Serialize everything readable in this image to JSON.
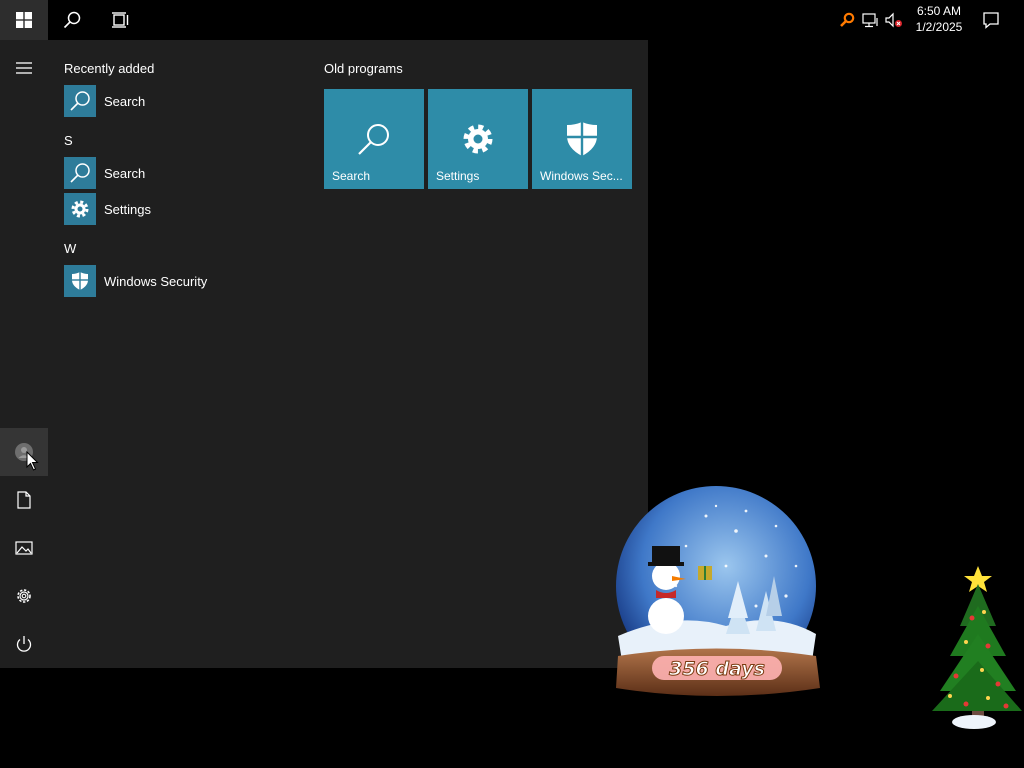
{
  "taskbar": {
    "clock_time": "6:50 AM",
    "clock_date": "1/2/2025",
    "icons": [
      "windows-logo-icon",
      "search-icon",
      "task-view-icon",
      "search-tray-icon",
      "network-icon",
      "volume-muted-icon",
      "notification-icon"
    ],
    "accent": "#ff7a00"
  },
  "start_menu": {
    "recently_added_title": "Recently added",
    "recently_added": [
      {
        "label": "Search",
        "icon": "search-icon"
      }
    ],
    "letter_s": "S",
    "s_items": [
      {
        "label": "Search",
        "icon": "search-icon"
      },
      {
        "label": "Settings",
        "icon": "gear-icon"
      }
    ],
    "letter_w": "W",
    "w_items": [
      {
        "label": "Windows Security",
        "icon": "shield-icon"
      }
    ],
    "rail": [
      "hamburger-icon",
      "user-icon",
      "documents-icon",
      "pictures-icon",
      "settings-icon",
      "power-icon"
    ]
  },
  "tiles": {
    "group_title": "Old programs",
    "items": [
      {
        "label": "Search",
        "icon": "search-icon"
      },
      {
        "label": "Settings",
        "icon": "gear-icon"
      },
      {
        "label": "Windows Sec...",
        "icon": "shield-icon"
      }
    ],
    "tile_color": "#2e8ca8"
  },
  "desktop": {
    "globe_label": "356 days"
  }
}
